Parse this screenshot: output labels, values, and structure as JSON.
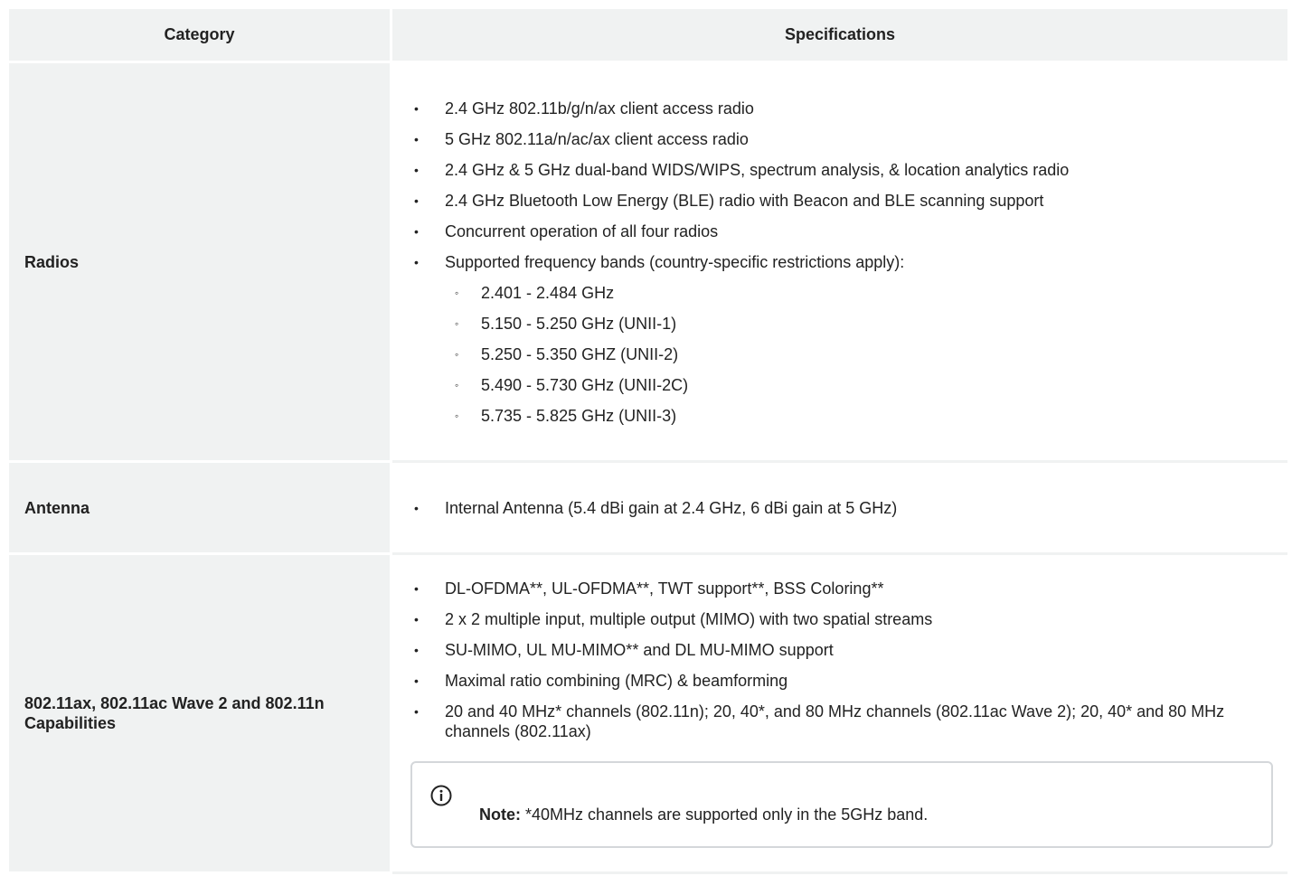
{
  "table": {
    "headers": [
      "Category",
      "Specifications"
    ],
    "rows": [
      {
        "category": "Radios",
        "items": [
          "2.4 GHz 802.11b/g/n/ax client access radio",
          "5 GHz 802.11a/n/ac/ax client access radio",
          "2.4 GHz & 5 GHz dual-band WIDS/WIPS, spectrum analysis, & location analytics radio",
          "2.4 GHz Bluetooth Low Energy (BLE) radio with Beacon and BLE scanning support",
          "Concurrent operation of all four radios",
          "Supported frequency bands (country-specific restrictions apply):"
        ],
        "subitems": [
          "2.401 - 2.484 GHz",
          "5.150 - 5.250 GHz (UNII-1)",
          "5.250 - 5.350 GHZ (UNII-2)",
          "5.490 - 5.730 GHz (UNII-2C)",
          "5.735 - 5.825 GHz (UNII-3)"
        ]
      },
      {
        "category": "Antenna",
        "items": [
          "Internal Antenna (5.4 dBi gain at 2.4 GHz, 6 dBi gain at 5 GHz)"
        ]
      },
      {
        "category": "802.11ax, 802.11ac Wave 2 and 802.11n Capabilities",
        "items": [
          "DL-OFDMA**, UL-OFDMA**, TWT support**, BSS Coloring**",
          "2 x 2 multiple input, multiple output (MIMO) with two spatial streams",
          "SU-MIMO, UL MU-MIMO** and DL MU-MIMO support",
          "Maximal ratio combining (MRC) & beamforming",
          "20 and 40 MHz* channels (802.11n); 20, 40*, and 80 MHz channels (802.11ac Wave 2); 20, 40* and 80 MHz channels (802.11ax)"
        ],
        "note": {
          "label": "Note:",
          "text": "*40MHz channels are supported only in the 5GHz band.",
          "icon": "info-icon"
        }
      }
    ]
  },
  "glyphs": {
    "bullet": "•",
    "subbullet": "◦"
  },
  "colors": {
    "header_bg": "#f0f2f2",
    "note_border": "#d4d7da",
    "text": "#222222"
  }
}
